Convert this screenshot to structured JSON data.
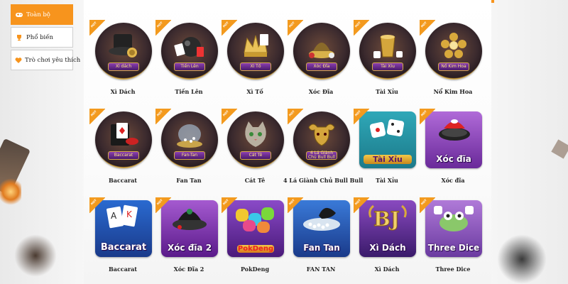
{
  "sidebar": {
    "items": [
      {
        "label": "Toàn bộ",
        "icon": "gamepad-icon",
        "active": true
      },
      {
        "label": "Phổ biến",
        "icon": "trophy-icon",
        "active": false
      },
      {
        "label": "Trò chơi yêu thích",
        "icon": "heart-icon",
        "active": false
      }
    ]
  },
  "search": {
    "placeholder": ""
  },
  "badge": "HOT",
  "colors": {
    "accent": "#f7941d",
    "purple": "#7b3fb0",
    "gold": "#d6a94a"
  },
  "games": [
    {
      "name": "Xì Dách",
      "art": "Xì dách"
    },
    {
      "name": "Tiến Lên",
      "art": "Tiến Lên"
    },
    {
      "name": "Xì Tố",
      "art": "Xì Tố"
    },
    {
      "name": "Xóc Đĩa",
      "art": "Xóc Đĩa"
    },
    {
      "name": "Tài Xỉu",
      "art": "Tài Xỉu"
    },
    {
      "name": "Nổ Kim Hoa",
      "art": "Nổ Kim Hoa"
    },
    {
      "name": "Baccarat",
      "art": "Baccarat"
    },
    {
      "name": "Fan Tan",
      "art": "Fan-Tan"
    },
    {
      "name": "Cát Tê",
      "art": "Cát Tê"
    },
    {
      "name": "4 Lá Giành Chủ Bull Bull",
      "art": "4 Lá Giành Chủ Bull Bull"
    },
    {
      "name": "Tài Xỉu",
      "art": "Tài Xỉu"
    },
    {
      "name": "Xóc đĩa",
      "art": "Xóc đĩa"
    },
    {
      "name": "Baccarat",
      "art": "Baccarat"
    },
    {
      "name": "Xóc Đĩa 2",
      "art": "Xóc đĩa 2"
    },
    {
      "name": "PokDeng",
      "art": "PokDeng"
    },
    {
      "name": "FAN    TAN",
      "art": "Fan Tan"
    },
    {
      "name": "Xì Dách",
      "art": "Xì Dách"
    },
    {
      "name": "Three Dice",
      "art": "Three Dice"
    }
  ]
}
